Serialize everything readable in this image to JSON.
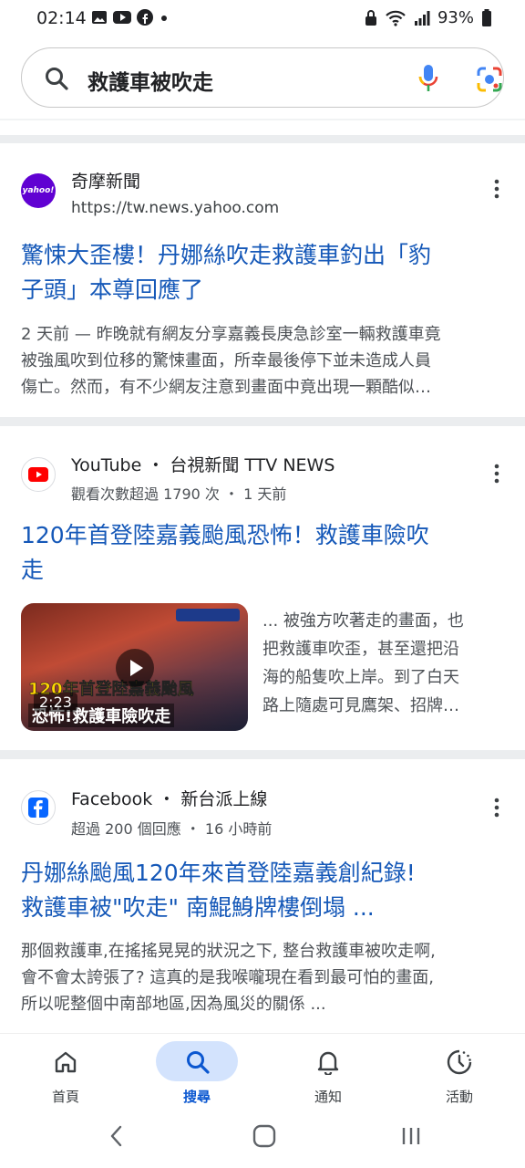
{
  "status": {
    "time": "02:14",
    "battery": "93%"
  },
  "search": {
    "query": "救護車被吹走"
  },
  "results": [
    {
      "site": "奇摩新聞",
      "url": "https://tw.news.yahoo.com",
      "favicon_text": "yahoo!",
      "title_line1": "驚悚大歪樓！丹娜絲吹走救護車釣出「豹",
      "title_line2": "子頭」本尊回應了",
      "snippet_line1": "2 天前 — 昨晚就有網友分享嘉義長庚急診室一輛救護車竟",
      "snippet_line2": "被強風吹到位移的驚悚畫面，所幸最後停下並未造成人員",
      "snippet_line3": "傷亡。然而，有不少網友注意到畫面中竟出現一顆酷似…"
    },
    {
      "site": "YouTube",
      "source": "台視新聞 TTV NEWS",
      "meta": "觀看次數超過 1790 次 ・ 1 天前",
      "title_line1": "120年首登陸嘉義颱風恐怖！救護車險吹",
      "title_line2": "走",
      "thumb_caption1": "120年首登陸嘉義颱風",
      "thumb_caption2": "恐怖!救護車險吹走",
      "duration": "2:23",
      "snippet_line1": "... 被強方吹著走的畫面，也",
      "snippet_line2": "把救護車吹歪，甚至還把沿",
      "snippet_line3": "海的船隻吹上岸。到了白天",
      "snippet_line4": "路上隨處可見鷹架、招牌…"
    },
    {
      "site": "Facebook",
      "source": "新台派上線",
      "meta": "超過 200 個回應 ・ 16 小時前",
      "title_line1": "丹娜絲颱風120年來首登陸嘉義創紀錄!",
      "title_line2": "救護車被\"吹走\" 南鯤鯓牌樓倒塌 ...",
      "snippet_line1": "那個救護車,在搖搖晃晃的狀況之下, 整台救護車被吹走啊,",
      "snippet_line2": "會不會太誇張了? 這真的是我喉嚨現在看到最可怕的畫面,",
      "snippet_line3": "所以呢整個中南部地區,因為風災的關係 ..."
    }
  ],
  "nav": [
    {
      "label": "首頁",
      "icon": "home-icon"
    },
    {
      "label": "搜尋",
      "icon": "search-icon"
    },
    {
      "label": "通知",
      "icon": "bell-icon"
    },
    {
      "label": "活動",
      "icon": "activity-icon"
    }
  ],
  "colors": {
    "link": "#1558b8",
    "accent": "#0b57d0",
    "yahoo": "#6001d2",
    "youtube": "#ff0000",
    "facebook": "#0866ff"
  }
}
